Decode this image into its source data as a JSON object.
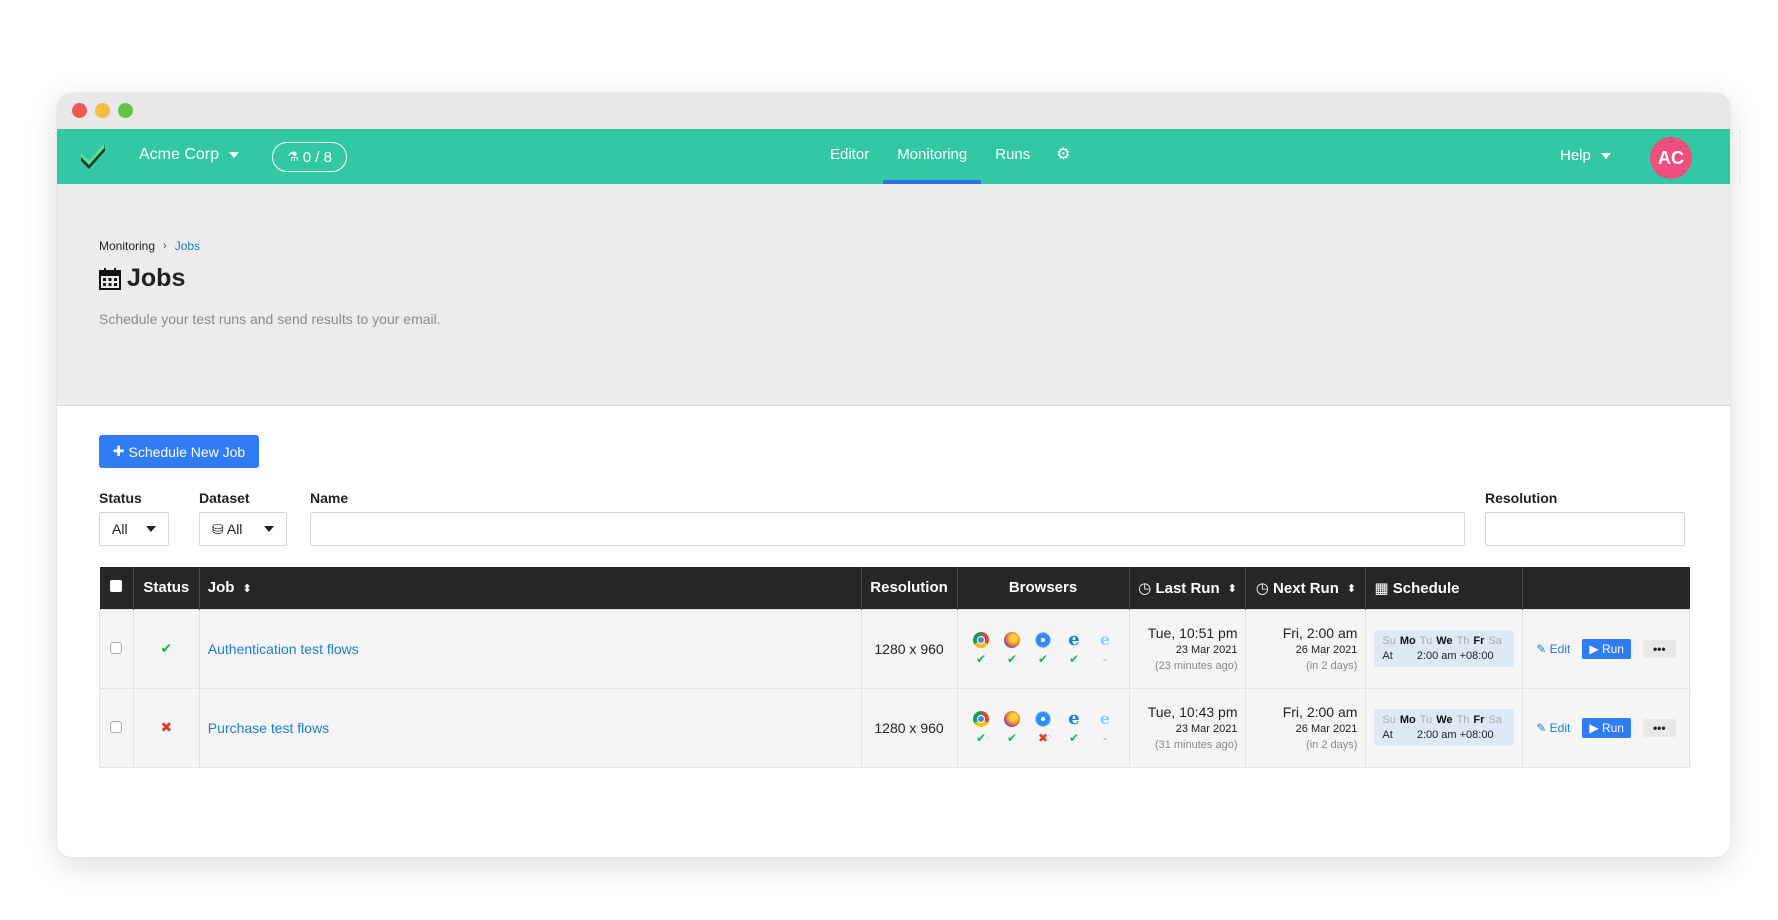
{
  "nav": {
    "org": "Acme Corp",
    "badge": "0 / 8",
    "links": [
      "Editor",
      "Monitoring",
      "Runs"
    ],
    "help": "Help",
    "avatar": "AC",
    "accent": "#32c8a4"
  },
  "breadcrumb": {
    "parent": "Monitoring",
    "current": "Jobs"
  },
  "page": {
    "title": "Jobs",
    "subtitle": "Schedule your test runs and send results to your email.",
    "new_job_button": "Schedule New Job"
  },
  "filters": {
    "status_label": "Status",
    "status_value": "All",
    "dataset_label": "Dataset",
    "dataset_value": "All",
    "name_label": "Name",
    "name_value": "",
    "resolution_label": "Resolution",
    "resolution_value": ""
  },
  "table": {
    "headers": {
      "status": "Status",
      "job": "Job",
      "resolution": "Resolution",
      "browsers": "Browsers",
      "last_run": "Last Run",
      "next_run": "Next Run",
      "schedule": "Schedule"
    },
    "browsers": [
      "chrome-icon",
      "firefox-icon",
      "safari-icon",
      "edge-icon",
      "ie-icon"
    ],
    "rows": [
      {
        "status": "passed",
        "status_glyph": "✔",
        "job": "Authentication test flows",
        "resolution": "1280 x 960",
        "browser_results": [
          "✔",
          "✔",
          "✔",
          "✔",
          "-"
        ],
        "last_run_time": "Tue, 10:51 pm",
        "last_run_date": "23 Mar 2021",
        "last_run_ago": "(23 minutes ago)",
        "next_run_time": "Fri, 2:00 am",
        "next_run_date": "26 Mar 2021",
        "next_run_in": "(in 2 days)",
        "days": [
          "Su",
          "Mo",
          "Tu",
          "We",
          "Th",
          "Fr",
          "Sa"
        ],
        "at_label": "At",
        "at_time": "2:00 am +08:00",
        "edit": "Edit",
        "run": "Run"
      },
      {
        "status": "failed",
        "status_glyph": "✖",
        "job": "Purchase test flows",
        "resolution": "1280 x 960",
        "browser_results": [
          "✔",
          "✔",
          "✖",
          "✔",
          "-"
        ],
        "last_run_time": "Tue, 10:43 pm",
        "last_run_date": "23 Mar 2021",
        "last_run_ago": "(31 minutes ago)",
        "next_run_time": "Fri, 2:00 am",
        "next_run_date": "26 Mar 2021",
        "next_run_in": "(in 2 days)",
        "days": [
          "Su",
          "Mo",
          "Tu",
          "We",
          "Th",
          "Fr",
          "Sa"
        ],
        "at_label": "At",
        "at_time": "2:00 am +08:00",
        "edit": "Edit",
        "run": "Run"
      }
    ]
  }
}
